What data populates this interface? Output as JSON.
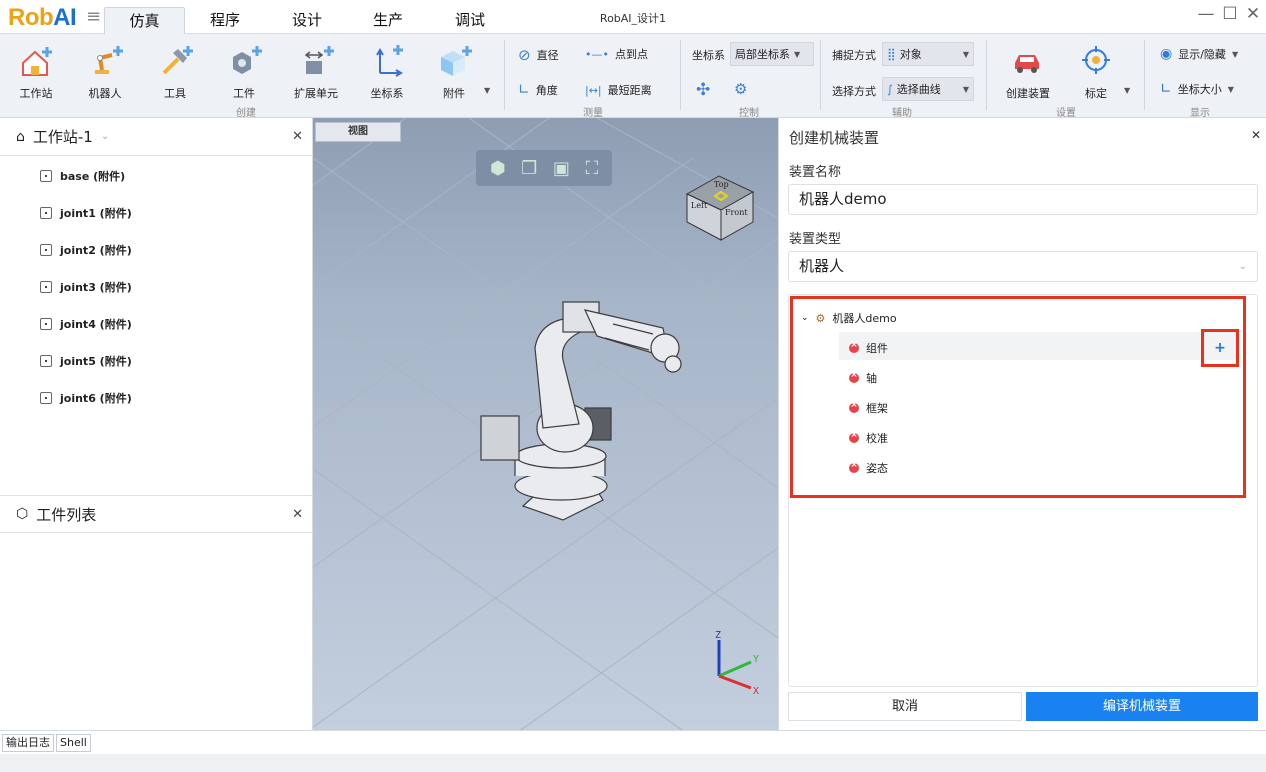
{
  "app": {
    "logo_prefix": "Rob",
    "logo_suffix": "AI",
    "document_title": "RobAI_设计1"
  },
  "menu_tabs": [
    {
      "label": "仿真",
      "active": true
    },
    {
      "label": "程序"
    },
    {
      "label": "设计"
    },
    {
      "label": "生产"
    },
    {
      "label": "调试"
    }
  ],
  "window_controls": {
    "minimize": "—",
    "maximize": "☐",
    "close": "✕"
  },
  "ribbon": {
    "create": {
      "group": "创建",
      "buttons": [
        "工作站",
        "机器人",
        "工具",
        "工件",
        "扩展单元",
        "坐标系",
        "附件"
      ]
    },
    "measure": {
      "group": "测量",
      "items": [
        "直径",
        "点到点",
        "角度",
        "最短距离"
      ]
    },
    "control": {
      "group": "控制",
      "frame_label": "坐标系",
      "frame_value": "局部坐标系"
    },
    "assist": {
      "group": "辅助",
      "capture_label": "捕捉方式",
      "capture_value": "对象",
      "select_label": "选择方式",
      "select_value": "选择曲线"
    },
    "settings": {
      "group": "设置",
      "create_device": "创建装置",
      "calibrate": "标定"
    },
    "display": {
      "group": "显示",
      "show_hide": "显示/隐藏",
      "axis_size": "坐标大小"
    }
  },
  "left_panel": {
    "station_title": "工作站-1",
    "items": [
      "base (附件)",
      "joint1 (附件)",
      "joint2 (附件)",
      "joint3 (附件)",
      "joint4 (附件)",
      "joint5 (附件)",
      "joint6 (附件)"
    ],
    "workpiece_title": "工件列表"
  },
  "viewport": {
    "tab": "视图",
    "cube_top": "Top",
    "cube_left": "Left",
    "cube_front": "Front",
    "axis_z": "Z",
    "axis_y": "Y",
    "axis_x": "X"
  },
  "right_panel": {
    "title": "创建机械装置",
    "name_label": "装置名称",
    "name_value": "机器人demo",
    "type_label": "装置类型",
    "type_value": "机器人",
    "tree_root": "机器人demo",
    "tree_children": [
      "组件",
      "轴",
      "框架",
      "校准",
      "姿态"
    ],
    "add_icon": "+",
    "cancel": "取消",
    "compile": "编译机械装置"
  },
  "bottom_tabs": [
    "输出日志",
    "Shell"
  ],
  "colors": {
    "accent": "#1a82f0",
    "highlight": "#e8321c",
    "logo": "#e8a317"
  }
}
